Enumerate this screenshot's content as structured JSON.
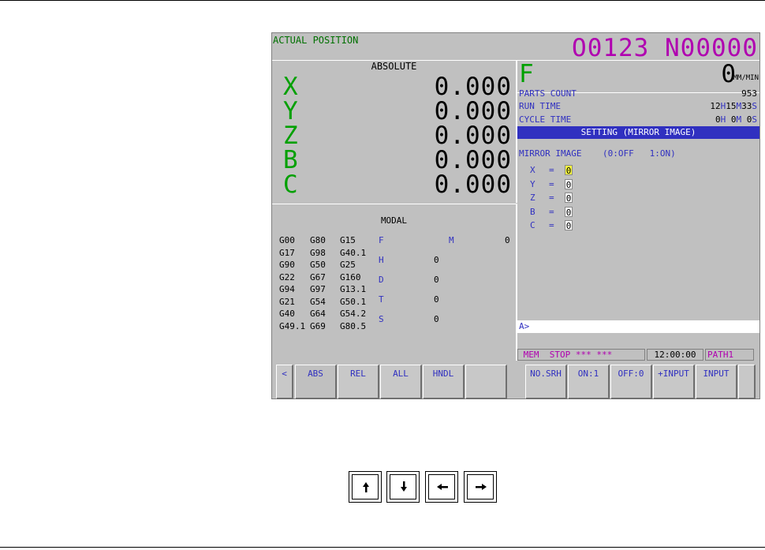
{
  "header": {
    "title": "ACTUAL POSITION",
    "program": "O0123 N00000"
  },
  "absolute": {
    "label": "ABSOLUTE",
    "axes": [
      {
        "name": "X",
        "value": "0.000"
      },
      {
        "name": "Y",
        "value": "0.000"
      },
      {
        "name": "Z",
        "value": "0.000"
      },
      {
        "name": "B",
        "value": "0.000"
      },
      {
        "name": "C",
        "value": "0.000"
      }
    ]
  },
  "modal": {
    "label": "MODAL",
    "rows": [
      [
        "G00",
        "G80",
        "G15"
      ],
      [
        "G17",
        "G98",
        "G40.1"
      ],
      [
        "G90",
        "G50",
        "G25"
      ],
      [
        "G22",
        "G67",
        "G160"
      ],
      [
        "G94",
        "G97",
        "G13.1"
      ],
      [
        "G21",
        "G54",
        "G50.1"
      ],
      [
        "G40",
        "G64",
        "G54.2"
      ],
      [
        "G49.1",
        "G69",
        "G80.5"
      ]
    ],
    "codes": [
      {
        "label": "F",
        "value": ""
      },
      {
        "label": "H",
        "value": "0"
      },
      {
        "label": "D",
        "value": "0"
      },
      {
        "label": "T",
        "value": "0"
      },
      {
        "label": "S",
        "value": "0"
      }
    ],
    "m_label": "M",
    "m_value": "0"
  },
  "feed": {
    "label": "F",
    "value": "0",
    "unit": "MM/MIN"
  },
  "info": {
    "parts_count_label": "PARTS COUNT",
    "parts_count_value": "953",
    "run_time_label": "RUN TIME",
    "run_time": {
      "h": "12",
      "m": "15",
      "s": "33"
    },
    "cycle_time_label": "CYCLE TIME",
    "cycle_time": {
      "h": "0",
      "m": "0",
      "s": "0"
    },
    "unit_h": "H",
    "unit_m": "M",
    "unit_s": "S"
  },
  "setting": {
    "title": "SETTING (MIRROR IMAGE)",
    "mirror_label": "MIRROR IMAGE",
    "mirror_hint": "(0:OFF   1:ON)",
    "axes": [
      {
        "name": "X",
        "value": "0"
      },
      {
        "name": "Y",
        "value": "0"
      },
      {
        "name": "Z",
        "value": "0"
      },
      {
        "name": "B",
        "value": "0"
      },
      {
        "name": "C",
        "value": "0"
      }
    ],
    "eq": "="
  },
  "command_prompt": "A>",
  "status": {
    "mode": "MEM",
    "state": "STOP",
    "stars1": "***",
    "stars2": "***",
    "time": "12:00:00",
    "path": "PATH1"
  },
  "softkeys": {
    "left_arrow": "<",
    "left": [
      "ABS",
      "REL",
      "ALL",
      "HNDL",
      ""
    ],
    "right": [
      "NO.SRH",
      "ON:1",
      "OFF:0",
      "+INPUT",
      "INPUT"
    ]
  },
  "cursor_keys": [
    "up-arrow-icon",
    "down-arrow-icon",
    "left-arrow-icon",
    "right-arrow-icon"
  ]
}
